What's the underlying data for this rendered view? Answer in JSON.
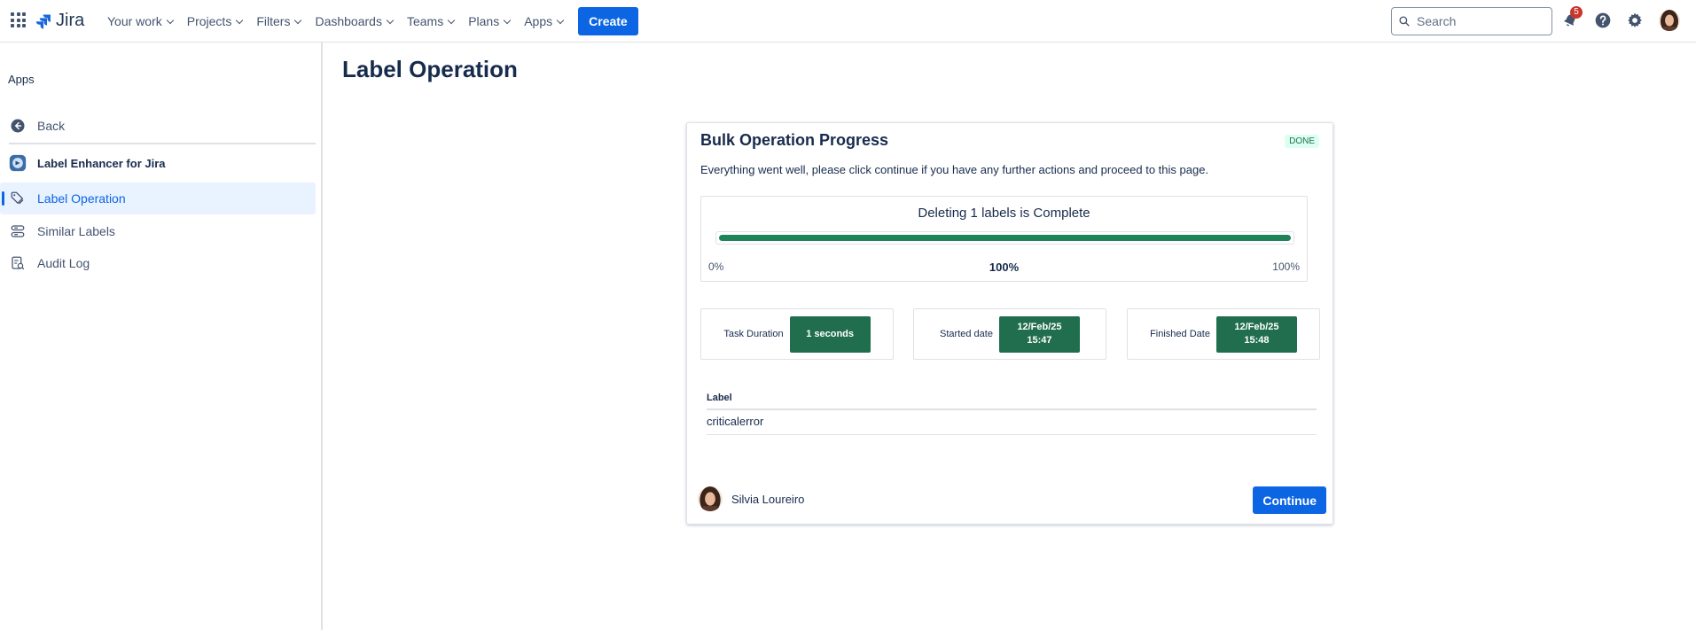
{
  "header": {
    "logo_text": "Jira",
    "nav": [
      "Your work",
      "Projects",
      "Filters",
      "Dashboards",
      "Teams",
      "Plans",
      "Apps"
    ],
    "create_label": "Create",
    "search_placeholder": "Search",
    "notifications_count": "5",
    "colors": {
      "primary": "#0c66e4",
      "text": "#44546f"
    }
  },
  "sidebar": {
    "heading": "Apps",
    "back_label": "Back",
    "app_name": "Label Enhancer for Jira",
    "items": [
      {
        "label": "Label Operation",
        "icon": "label-tag-icon",
        "active": true
      },
      {
        "label": "Similar Labels",
        "icon": "stack-icon",
        "active": false
      },
      {
        "label": "Audit Log",
        "icon": "audit-log-icon",
        "active": false
      }
    ]
  },
  "main": {
    "title": "Label Operation",
    "card": {
      "title": "Bulk Operation Progress",
      "status": "DONE",
      "description": "Everything went well, please click continue if you have any further actions and proceed to this page.",
      "progress": {
        "title": "Deleting 1 labels is Complete",
        "percent": 1.0,
        "min_label": "0%",
        "value_label": "100%",
        "max_label": "100%",
        "color": "#1f845a"
      },
      "stats": [
        {
          "label": "Task Duration",
          "value": "1 seconds"
        },
        {
          "label": "Started date",
          "value": "12/Feb/25 15:47"
        },
        {
          "label": "Finished Date",
          "value": "12/Feb/25 15:48"
        }
      ],
      "table": {
        "header": "Label",
        "rows": [
          "criticalerror"
        ]
      },
      "user_name": "Silvia Loureiro",
      "continue_label": "Continue"
    }
  }
}
